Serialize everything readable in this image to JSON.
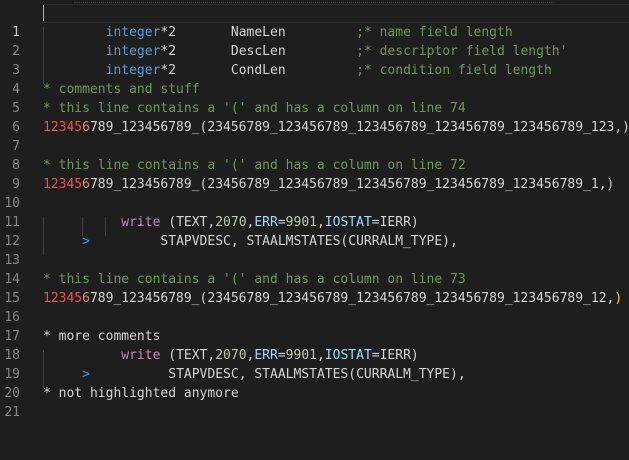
{
  "editor": {
    "line_numbers": [
      "1",
      "2",
      "3",
      "4",
      "5",
      "6",
      "7",
      "8",
      "9",
      "10",
      "11",
      "12",
      "13",
      "14",
      "15",
      "16",
      "17",
      "18",
      "19",
      "20",
      "21"
    ],
    "colors": {
      "background": "#1e1e1e",
      "comment": "#6a9955",
      "type": "#569cd6",
      "keyword": "#c586c0",
      "attribute": "#9cdcfe",
      "number": "#b5cea8",
      "label": "#f14c4c",
      "continuation": "#ce9178"
    },
    "icons": {
      "continuation_marker": "chevron-right-icon"
    },
    "lines": {
      "l2": {
        "indent": "        ",
        "type": "integer",
        "mult": "*2",
        "gap1": "       ",
        "name": "NameLen",
        "gap2": "         ",
        "comment": ";* name field length"
      },
      "l3": {
        "indent": "        ",
        "type": "integer",
        "mult": "*2",
        "gap1": "       ",
        "name": "DescLen",
        "gap2": "         ",
        "comment": ";* descriptor field length'"
      },
      "l4": {
        "indent": "        ",
        "type": "integer",
        "mult": "*2",
        "gap1": "       ",
        "name": "CondLen",
        "gap2": "         ",
        "comment": ";* condition field length"
      },
      "l5": "* comments and stuff",
      "l6": "* this line contains a '(' and has a column on line 74",
      "l7": {
        "label": "12345",
        "cont": "6",
        "rest": "789_123456789_(23456789_123456789_123456789_123456789_123456789_123,)"
      },
      "l9": "* this line contains a '(' and has a column on line 72",
      "l10": {
        "label": "12345",
        "cont": "6",
        "rest": "789_123456789_(23456789_123456789_123456789_123456789_123456789_1,)"
      },
      "l12": {
        "indent": "          ",
        "kw": "write",
        "sp": " ",
        "open": "(",
        "text": "TEXT",
        "c1": ",",
        "n1": "2070",
        "c2": ",",
        "err": "ERR",
        "eq1": "=",
        "n2": "9901",
        "c3": ",",
        "iostat": "IOSTAT",
        "eq2": "=",
        "ierr": "IERR",
        "close": ")"
      },
      "l13": {
        "indent": "     ",
        "marker": ">",
        "pad": "         ",
        "text": "STAPVDESC, STAALMSTATES(CURRALM_TYPE),"
      },
      "l15": "* this line contains a '(' and has a column on line 73",
      "l16": {
        "label": "12345",
        "cont": "6",
        "rest": "789_123456789_(23456789_123456789_123456789_123456789_123456789_12,",
        "close": ")"
      },
      "l18": "* more comments",
      "l19": {
        "indent": "          ",
        "kw": "write",
        "sp": " ",
        "open": "(",
        "text": "TEXT",
        "c1": ",",
        "n1": "2070",
        "c2": ",",
        "err": "ERR",
        "eq1": "=",
        "n2": "9901",
        "c3": ",",
        "iostat": "IOSTAT",
        "eq2": "=",
        "ierr": "IERR",
        "close": ")"
      },
      "l20": {
        "indent": "     ",
        "marker": ">",
        "pad": "          ",
        "text": "STAPVDESC, STAALMSTATES(CURRALM_TYPE),"
      },
      "l21": "* not highlighted anymore"
    }
  }
}
